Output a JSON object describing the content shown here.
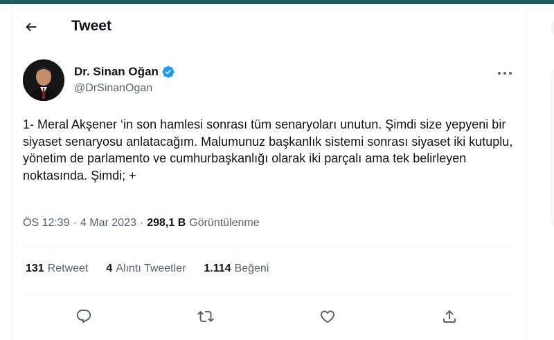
{
  "header": {
    "title": "Tweet"
  },
  "author": {
    "display_name": "Dr. Sinan Oğan",
    "handle": "@DrSinanOgan",
    "verified_color": "#1d9bf0"
  },
  "tweet": {
    "text": "1- Meral Akşener ‘in son hamlesi sonrası tüm senaryoları unutun. Şimdi size yepyeni bir siyaset senaryosu anlatacağım. Malumunuz başkanlık sistemi sonrası siyaset iki kutuplu, yönetim de parlamento ve cumhurbaşkanlığı olarak iki parçalı ama tek belirleyen noktasında. Şimdi; +"
  },
  "meta": {
    "time": "ÖS 12:39",
    "sep1": "·",
    "date": "4 Mar 2023",
    "sep2": "·",
    "views_count": "298,1 B",
    "views_label": "Görüntülenme"
  },
  "stats": {
    "retweets_count": "131",
    "retweets_label": "Retweet",
    "quotes_count": "4",
    "quotes_label": "Alıntı Tweetler",
    "likes_count": "1.114",
    "likes_label": "Beğeni"
  },
  "icons": {
    "back": "arrow-left-icon",
    "more": "more-horizontal-icon",
    "reply": "reply-icon",
    "retweet": "retweet-icon",
    "like": "heart-icon",
    "share": "share-icon"
  },
  "colors": {
    "accent": "#1d9bf0",
    "top_bar": "#1f5e5a",
    "muted_text": "#536471"
  }
}
